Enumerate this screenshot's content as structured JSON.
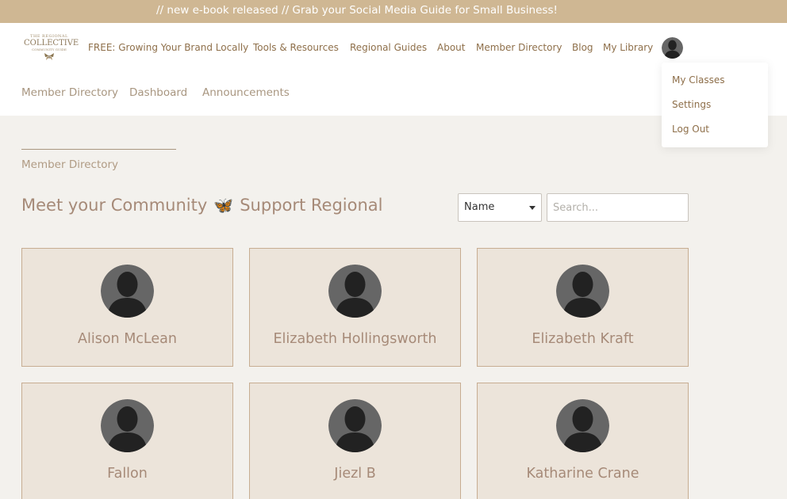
{
  "announcement": "// new e-book released // Grab your Social Media Guide for Small Business!",
  "logo": {
    "line1": "THE REGIONAL",
    "line2": "COLLECTIVE",
    "line3": "COMMUNITY GUIDE"
  },
  "nav": [
    {
      "label": "FREE: Growing Your Brand Locally"
    },
    {
      "label": "Tools & Resources"
    },
    {
      "label": "Regional Guides"
    },
    {
      "label": "About"
    },
    {
      "label": "Member Directory"
    },
    {
      "label": "Blog"
    },
    {
      "label": "My Library"
    }
  ],
  "sub_nav": [
    {
      "label": "Member Directory"
    },
    {
      "label": "Dashboard"
    },
    {
      "label": "Announcements"
    }
  ],
  "user_menu": [
    {
      "label": "My Classes"
    },
    {
      "label": "Settings"
    },
    {
      "label": "Log Out"
    }
  ],
  "breadcrumb": "Member Directory",
  "page_title": {
    "part1": "Meet your Community",
    "emoji": "🦋",
    "part2": "Support Regional"
  },
  "filter": {
    "selected": "Name",
    "search_placeholder": "Search..."
  },
  "members": [
    {
      "name": "Alison McLean"
    },
    {
      "name": "Elizabeth Hollingsworth"
    },
    {
      "name": "Elizabeth Kraft"
    },
    {
      "name": "Fallon"
    },
    {
      "name": "Jiezl B"
    },
    {
      "name": "Katharine Crane"
    }
  ],
  "colors": {
    "announcement_bg": "#cfb793",
    "nav_text": "#8e6f4a",
    "card_bg": "#ece4da",
    "card_border": "#c7ad92",
    "title_text": "#a68a78"
  }
}
